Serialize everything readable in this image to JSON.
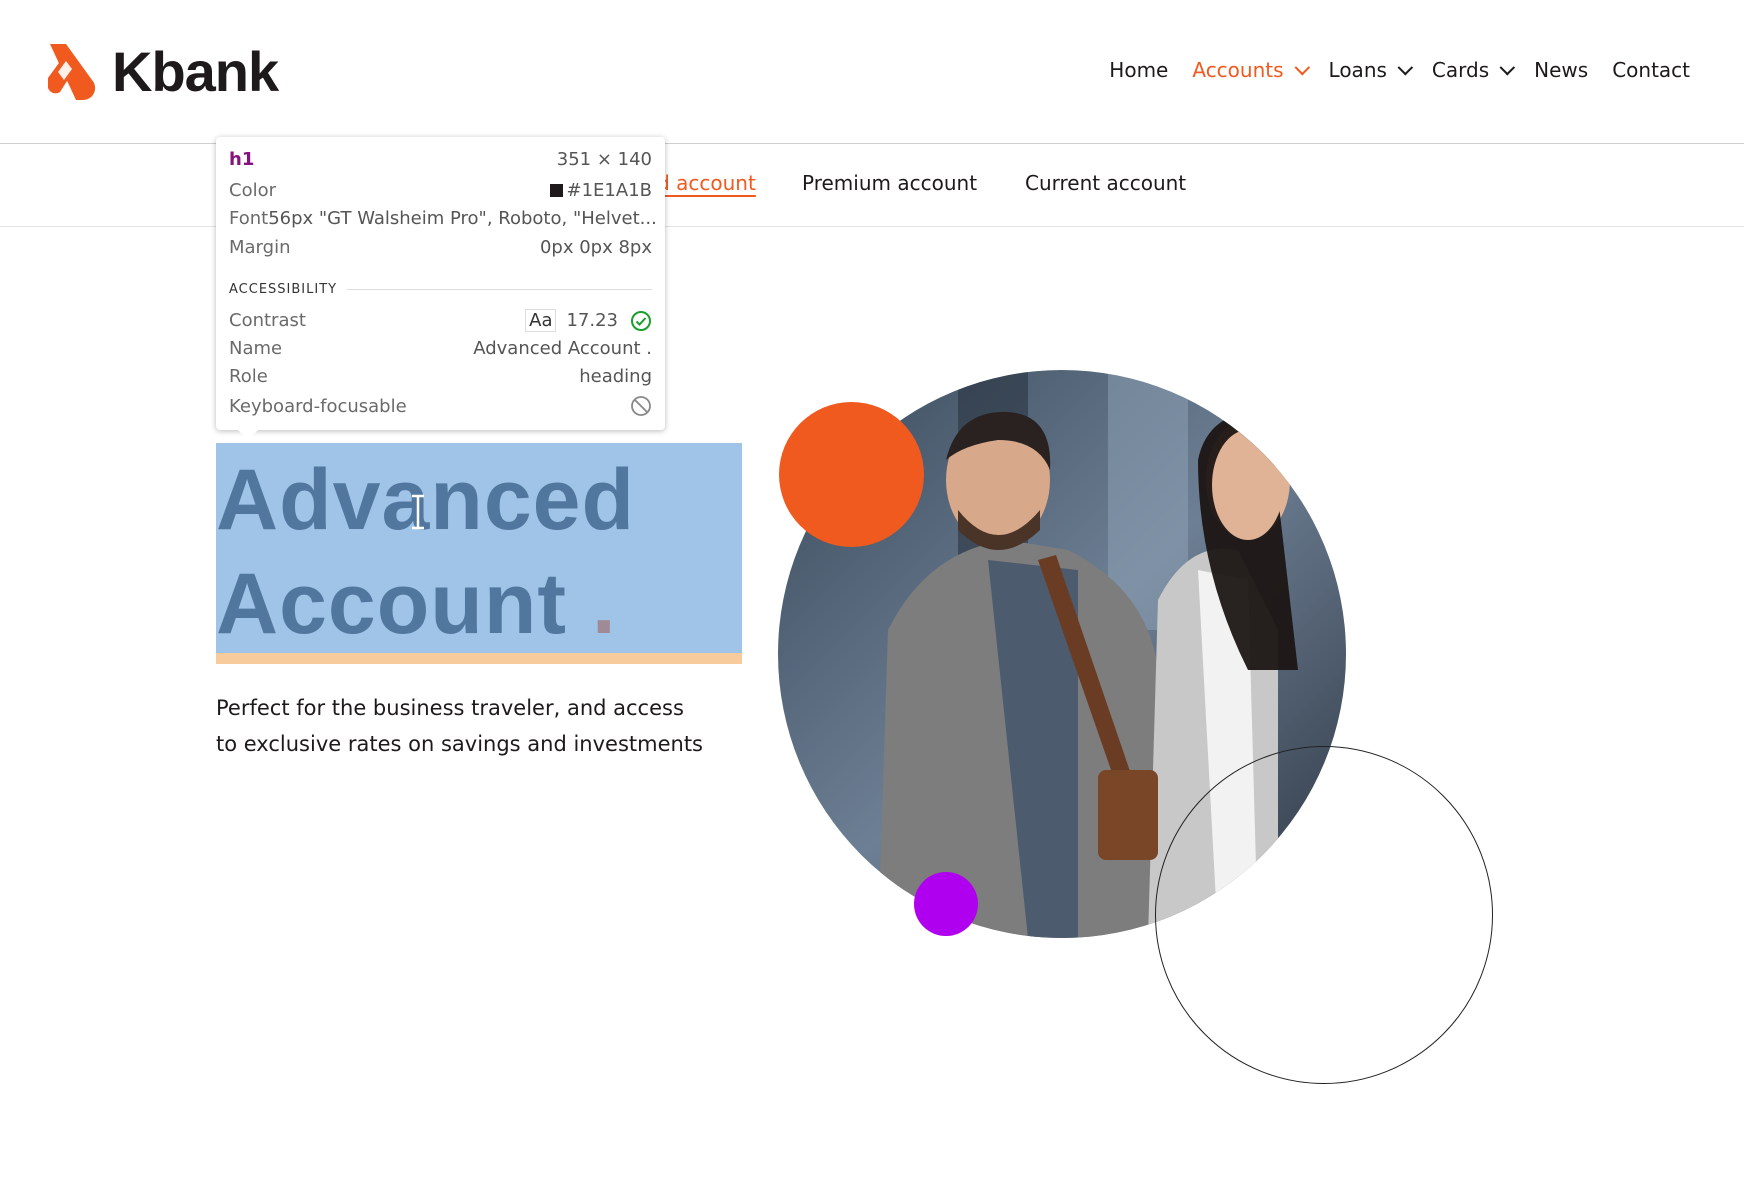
{
  "brand": {
    "name": "Kbank",
    "color": "#f05a1e"
  },
  "nav": {
    "items": [
      {
        "label": "Home",
        "dropdown": false,
        "active": false
      },
      {
        "label": "Accounts",
        "dropdown": true,
        "active": true
      },
      {
        "label": "Loans",
        "dropdown": true,
        "active": false
      },
      {
        "label": "Cards",
        "dropdown": true,
        "active": false
      },
      {
        "label": "News",
        "dropdown": false,
        "active": false
      },
      {
        "label": "Contact",
        "dropdown": false,
        "active": false
      }
    ]
  },
  "subnav": {
    "items": [
      {
        "label": "Advanced account",
        "active": true
      },
      {
        "label": "Premium account",
        "active": false
      },
      {
        "label": "Current account",
        "active": false
      }
    ]
  },
  "hero": {
    "title_line1": "Advanced",
    "title_line2": "Account",
    "title_dot": ".",
    "description_line1": "Perfect for the business traveler, and access",
    "description_line2": "to exclusive rates on savings and investments"
  },
  "inspector": {
    "tag": "h1",
    "size": "351 × 140",
    "color_label": "Color",
    "color_value": "#1E1A1B",
    "font_label": "Font",
    "font_value": "56px \"GT Walsheim Pro\", Roboto, \"Helvet...",
    "margin_label": "Margin",
    "margin_value": "0px 0px 8px",
    "section": "ACCESSIBILITY",
    "contrast_label": "Contrast",
    "contrast_sample": "Aa",
    "contrast_value": "17.23",
    "name_label": "Name",
    "name_value": "Advanced Account .",
    "role_label": "Role",
    "role_value": "heading",
    "focus_label": "Keyboard-focusable",
    "icons": {
      "contrast": "check-circle-icon",
      "focus": "not-allowed-icon"
    }
  },
  "colors": {
    "accent": "#f05a1e",
    "purple": "#b000f0",
    "highlight": "#a0c4e8",
    "margin_band": "#f8cb9c",
    "heading_selected": "#52779e"
  }
}
